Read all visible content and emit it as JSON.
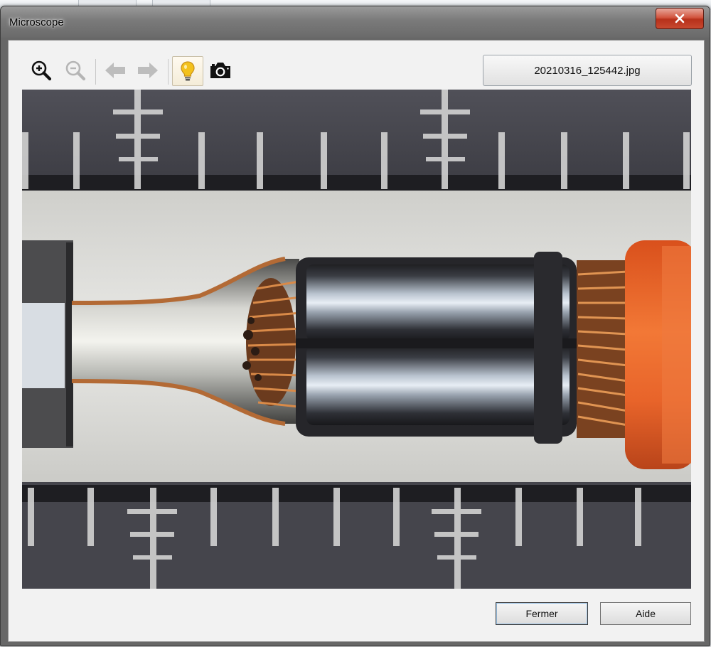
{
  "window": {
    "title": "Microscope"
  },
  "toolbar": {
    "zoom_in": "zoom-in-icon",
    "zoom_out": "zoom-out-icon",
    "back": "arrow-left-icon",
    "forward": "arrow-right-icon",
    "light": "light-bulb-icon",
    "camera": "camera-icon",
    "light_active": true
  },
  "file": {
    "name": "20210316_125442.jpg"
  },
  "footer": {
    "close_label": "Fermer",
    "help_label": "Aide"
  },
  "colors": {
    "close_red": "#c7482f",
    "insulation_orange": "#e8642a",
    "copper": "#c9743c",
    "bulb_yellow": "#f3c11c"
  }
}
